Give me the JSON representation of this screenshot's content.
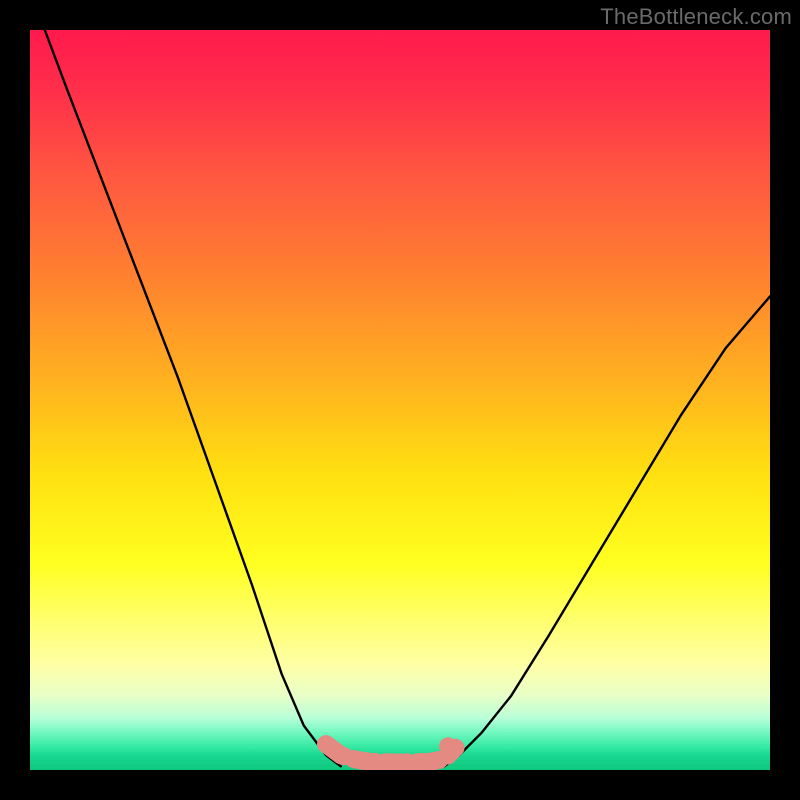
{
  "watermark": "TheBottleneck.com",
  "chart_data": {
    "type": "line",
    "title": "",
    "xlabel": "",
    "ylabel": "",
    "xlim": [
      0,
      100
    ],
    "ylim": [
      0,
      100
    ],
    "grid": false,
    "legend": false,
    "series": [
      {
        "name": "curve-left",
        "x": [
          2,
          5,
          10,
          15,
          20,
          25,
          30,
          34,
          37,
          40,
          42
        ],
        "y": [
          100,
          92,
          79,
          66,
          53,
          39,
          25,
          13,
          6,
          2,
          0.5
        ],
        "color": "#000000"
      },
      {
        "name": "curve-right",
        "x": [
          56,
          58,
          61,
          65,
          70,
          76,
          82,
          88,
          94,
          100
        ],
        "y": [
          0.5,
          2,
          5,
          10,
          18,
          28,
          38,
          48,
          57,
          64
        ],
        "color": "#000000"
      },
      {
        "name": "marker-segment",
        "x": [
          40,
          42,
          44,
          46,
          50,
          54,
          56,
          57.5
        ],
        "y": [
          3.5,
          2,
          1.4,
          1.1,
          1,
          1.1,
          1.5,
          3
        ],
        "color": "#e58a82"
      }
    ],
    "annotations": [
      {
        "type": "dot",
        "x": 56.5,
        "y": 3.2,
        "color": "#e58a82"
      }
    ],
    "background": {
      "type": "vertical-gradient",
      "stops": [
        {
          "pos": 0.0,
          "color": "#ff1a4d"
        },
        {
          "pos": 0.2,
          "color": "#ff5840"
        },
        {
          "pos": 0.47,
          "color": "#ffb020"
        },
        {
          "pos": 0.72,
          "color": "#ffff20"
        },
        {
          "pos": 0.9,
          "color": "#e8ffc8"
        },
        {
          "pos": 1.0,
          "color": "#0fc77e"
        }
      ]
    }
  }
}
